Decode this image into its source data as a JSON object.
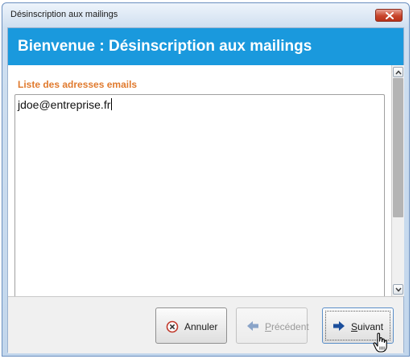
{
  "window": {
    "title": "Désinscription aux mailings"
  },
  "banner": {
    "title": "Bienvenue : Désinscription aux mailings"
  },
  "email_list": {
    "label": "Liste des adresses emails",
    "value": "jdoe@entreprise.fr"
  },
  "buttons": {
    "cancel": {
      "label": "Annuler",
      "icon": "cancel-circle-icon"
    },
    "previous": {
      "mnemonic": "P",
      "rest": "récédent",
      "icon": "arrow-left-icon",
      "enabled": false
    },
    "next": {
      "mnemonic": "S",
      "rest": "uivant",
      "icon": "arrow-right-icon",
      "enabled": true
    }
  },
  "colors": {
    "banner": "#1a99dd",
    "label": "#e07a2e",
    "arrow": "#1c4f9c",
    "cancel_icon": "#c0392b"
  }
}
